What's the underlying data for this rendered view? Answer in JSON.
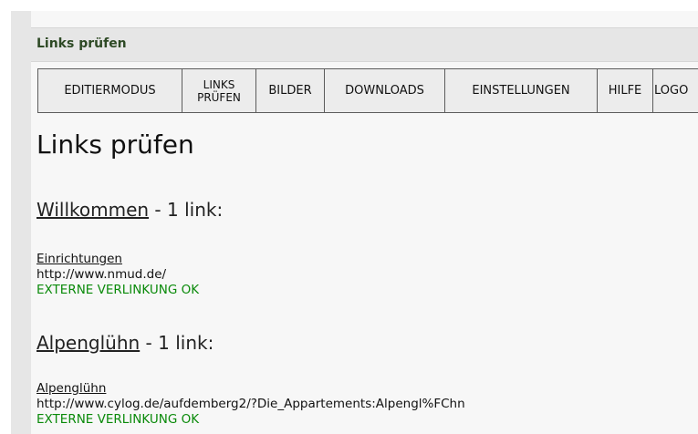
{
  "panel": {
    "title": "Links prüfen"
  },
  "toolbar": {
    "items": [
      {
        "label": "EDITIERMODUS"
      },
      {
        "label_line1": "LINKS",
        "label_line2": "PRÜFEN"
      },
      {
        "label": "BILDER"
      },
      {
        "label": "DOWNLOADS"
      },
      {
        "label": "EINSTELLUNGEN"
      },
      {
        "label": "HILFE"
      },
      {
        "label": "LOGO"
      }
    ]
  },
  "main": {
    "heading": "Links prüfen",
    "sections": [
      {
        "page_name": "Willkommen",
        "count_text": " - 1 link:",
        "entries": [
          {
            "link_text": "Einrichtungen",
            "url": "http://www.nmud.de/",
            "status": "EXTERNE VERLINKUNG OK"
          }
        ]
      },
      {
        "page_name": "Alpenglühn",
        "count_text": " - 1 link:",
        "entries": [
          {
            "link_text": "Alpenglühn",
            "url": "http://www.cylog.de/aufdemberg2/?Die_Appartements:Alpengl%FChn",
            "status": "EXTERNE VERLINKUNG OK"
          }
        ]
      }
    ]
  },
  "colors": {
    "status_ok": "#0a8a0a",
    "panel_title": "#2e4a25",
    "header_bg": "#e6e6e6"
  }
}
